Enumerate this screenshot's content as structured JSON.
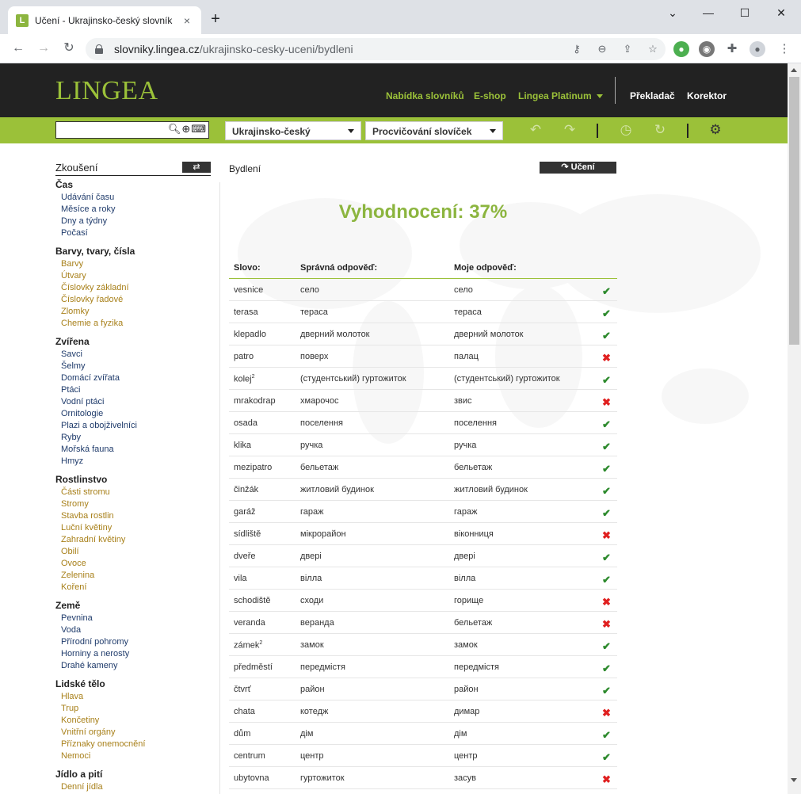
{
  "browser": {
    "tab_title": "Učení - Ukrajinsko-český slovník",
    "tab_close": "×",
    "new_tab": "+",
    "url_domain": "slovniky.lingea.cz",
    "url_path": "/ukrajinsko-cesky-uceni/bydleni"
  },
  "site": {
    "logo": "LINGEA",
    "nav": {
      "dictionaries": "Nabídka slovníků",
      "eshop": "E-shop",
      "platinum": "Lingea Platinum",
      "translator": "Překladač",
      "corrector": "Korektor"
    },
    "toolbar": {
      "search_value": "",
      "dict_select": "Ukrajinsko-český",
      "mode_select": "Procvičování slovíček"
    }
  },
  "sidebar": {
    "title": "Zkoušení",
    "swap": "⇄",
    "categories": [
      {
        "name": "Čas",
        "color": "blue",
        "items": [
          "Udávání času",
          "Měsíce a roky",
          "Dny a týdny",
          "Počasí"
        ]
      },
      {
        "name": "Barvy, tvary, čísla",
        "color": "gold",
        "items": [
          "Barvy",
          "Útvary",
          "Číslovky základní",
          "Číslovky řadové",
          "Zlomky",
          "Chemie a fyzika"
        ]
      },
      {
        "name": "Zvířena",
        "color": "blue",
        "items": [
          "Savci",
          "Šelmy",
          "Domácí zvířata",
          "Ptáci",
          "Vodní ptáci",
          "Ornitologie",
          "Plazi a obojživelníci",
          "Ryby",
          "Mořská fauna",
          "Hmyz"
        ]
      },
      {
        "name": "Rostlinstvo",
        "color": "gold",
        "items": [
          "Části stromu",
          "Stromy",
          "Stavba rostlin",
          "Luční květiny",
          "Zahradní květiny",
          "Obilí",
          "Ovoce",
          "Zelenina",
          "Koření"
        ]
      },
      {
        "name": "Země",
        "color": "blue",
        "items": [
          "Pevnina",
          "Voda",
          "Přírodní pohromy",
          "Horniny a nerosty",
          "Drahé kameny"
        ]
      },
      {
        "name": "Lidské tělo",
        "color": "gold",
        "items": [
          "Hlava",
          "Trup",
          "Končetiny",
          "Vnitřní orgány",
          "Příznaky onemocnění",
          "Nemoci"
        ]
      },
      {
        "name": "Jídlo a pití",
        "color": "gold",
        "items": [
          "Denní jídla"
        ]
      }
    ]
  },
  "main": {
    "title": "Bydlení",
    "learn_button": "Učení",
    "result": "Vyhodnocení: 37%",
    "headers": {
      "word": "Slovo:",
      "correct": "Správná odpověď:",
      "mine": "Moje odpověď:"
    },
    "rows": [
      {
        "word": "vesnice",
        "sup": "",
        "correct": "село",
        "mine": "село",
        "ok": true
      },
      {
        "word": "terasa",
        "sup": "",
        "correct": "тераса",
        "mine": "тераса",
        "ok": true
      },
      {
        "word": "klepadlo",
        "sup": "",
        "correct": "дверний молоток",
        "mine": "дверний молоток",
        "ok": true
      },
      {
        "word": "patro",
        "sup": "",
        "correct": "поверх",
        "mine": "палац",
        "ok": false
      },
      {
        "word": "kolej",
        "sup": "2",
        "correct": "(студентський) гуртожиток",
        "mine": "(студентський) гуртожиток",
        "ok": true
      },
      {
        "word": "mrakodrap",
        "sup": "",
        "correct": "хмарочос",
        "mine": "звис",
        "ok": false
      },
      {
        "word": "osada",
        "sup": "",
        "correct": "поселення",
        "mine": "поселення",
        "ok": true
      },
      {
        "word": "klika",
        "sup": "",
        "correct": "ручка",
        "mine": "ручка",
        "ok": true
      },
      {
        "word": "mezipatro",
        "sup": "",
        "correct": "бельетаж",
        "mine": "бельетаж",
        "ok": true
      },
      {
        "word": "činžák",
        "sup": "",
        "correct": "житловий будинок",
        "mine": "житловий будинок",
        "ok": true
      },
      {
        "word": "garáž",
        "sup": "",
        "correct": "гараж",
        "mine": "гараж",
        "ok": true
      },
      {
        "word": "sídliště",
        "sup": "",
        "correct": "мікрорайон",
        "mine": "віконниця",
        "ok": false
      },
      {
        "word": "dveře",
        "sup": "",
        "correct": "двері",
        "mine": "двері",
        "ok": true
      },
      {
        "word": "vila",
        "sup": "",
        "correct": "вілла",
        "mine": "вілла",
        "ok": true
      },
      {
        "word": "schodiště",
        "sup": "",
        "correct": "сходи",
        "mine": "горище",
        "ok": false
      },
      {
        "word": "veranda",
        "sup": "",
        "correct": "веранда",
        "mine": "бельетаж",
        "ok": false
      },
      {
        "word": "zámek",
        "sup": "2",
        "correct": "замок",
        "mine": "замок",
        "ok": true
      },
      {
        "word": "předměstí",
        "sup": "",
        "correct": "передмістя",
        "mine": "передмістя",
        "ok": true
      },
      {
        "word": "čtvrť",
        "sup": "",
        "correct": "район",
        "mine": "район",
        "ok": true
      },
      {
        "word": "chata",
        "sup": "",
        "correct": "котедж",
        "mine": "димар",
        "ok": false
      },
      {
        "word": "dům",
        "sup": "",
        "correct": "дім",
        "mine": "дім",
        "ok": true
      },
      {
        "word": "centrum",
        "sup": "",
        "correct": "центр",
        "mine": "центр",
        "ok": true
      },
      {
        "word": "ubytovna",
        "sup": "",
        "correct": "гуртожиток",
        "mine": "засув",
        "ok": false
      }
    ]
  },
  "colors": {
    "accent": "#9bc139",
    "ok": "#2d8a2d",
    "bad": "#e02020",
    "header": "#222222"
  }
}
